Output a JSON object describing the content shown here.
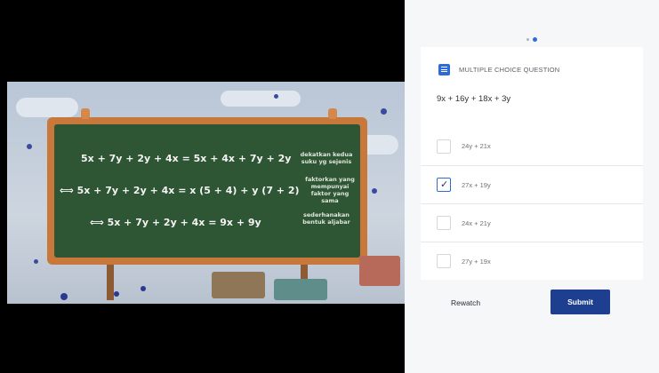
{
  "video": {
    "equations": [
      "5x + 7y + 2y + 4x = 5x + 4x + 7y + 2y",
      "⟺ 5x + 7y + 2y + 4x = x (5 + 4) + y (7 + 2)",
      "⟺ 5x + 7y + 2y + 4x = 9x + 9y"
    ],
    "notes": [
      "dekatkan kedua\nsuku yg sejenis",
      "faktorkan yang\nmempunyai\nfaktor yang\nsama",
      "sederhanakan\nbentuk aljabar"
    ]
  },
  "pager": {
    "count": 2,
    "active": 1
  },
  "question": {
    "type_label": "MULTIPLE CHOICE QUESTION",
    "type_icon": "list-icon",
    "text": "9x + 16y + 18x + 3y",
    "options": [
      {
        "label": "24y + 21x",
        "selected": false
      },
      {
        "label": "27x + 19y",
        "selected": true
      },
      {
        "label": "24x + 21y",
        "selected": false
      },
      {
        "label": "27y + 19x",
        "selected": false
      }
    ]
  },
  "actions": {
    "rewatch_label": "Rewatch",
    "submit_label": "Submit"
  },
  "colors": {
    "accent": "#2f6bd8",
    "submit": "#1e3f8f",
    "board": "#2e5534",
    "frame": "#c9783c"
  }
}
